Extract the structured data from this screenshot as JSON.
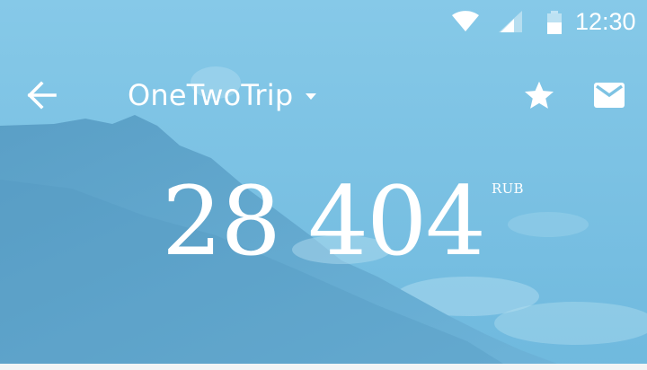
{
  "status_bar": {
    "time": "12:30",
    "icons": [
      "wifi-icon",
      "cellular-signal-icon",
      "battery-icon"
    ]
  },
  "toolbar": {
    "title": "OneTwoTrip",
    "icons": [
      "back-arrow-icon",
      "dropdown-arrow-icon",
      "star-icon",
      "mail-icon"
    ]
  },
  "price": {
    "amount": "28 404",
    "currency": "RUB"
  },
  "colors": {
    "sky": "#7ec3e3",
    "mountain": "#5ca3c8",
    "foreground": "#ffffff"
  }
}
